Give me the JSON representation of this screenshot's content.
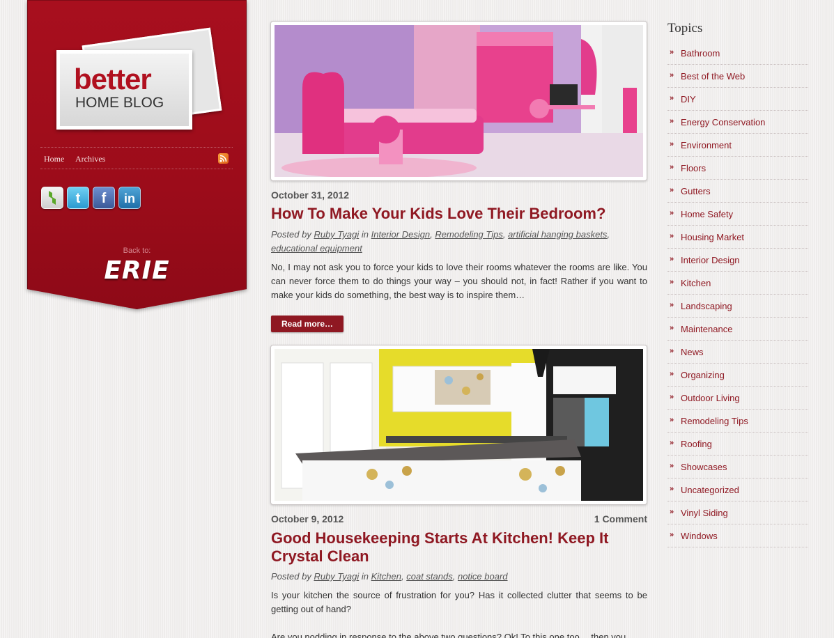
{
  "brand": {
    "logo_word1": "better",
    "logo_word2": "HOME BLOG",
    "back_to_label": "Back to:",
    "back_to_city": "ERIE"
  },
  "nav": {
    "home": "Home",
    "archives": "Archives",
    "rss_icon": "rss-icon"
  },
  "social": [
    {
      "name": "houzz-icon",
      "glyph": "h"
    },
    {
      "name": "twitter-icon",
      "glyph": "t"
    },
    {
      "name": "facebook-icon",
      "glyph": "f"
    },
    {
      "name": "linkedin-icon",
      "glyph": "in"
    }
  ],
  "posts": [
    {
      "date": "October 31, 2012",
      "title": "How To Make Your Kids Love Their Bedroom?",
      "posted_by": "Posted by",
      "author": "Ruby Tyagi",
      "in": "in",
      "tags": [
        "Interior Design",
        "Remodeling Tips",
        "artificial hanging baskets",
        "educational equipment"
      ],
      "excerpt": "No, I may not ask you to force your kids to love their rooms whatever the rooms are like. You can never force them to do things your way – you should not, in fact! Rather if you want to make your kids do something, the best way is to inspire them…",
      "read_more": "Read more…"
    },
    {
      "date": "October 9, 2012",
      "comments": "1 Comment",
      "title": "Good Housekeeping Starts At Kitchen! Keep It Crystal Clean",
      "posted_by": "Posted by",
      "author": "Ruby Tyagi",
      "in": "in",
      "tags": [
        "Kitchen",
        "coat stands",
        "notice board"
      ],
      "excerpt": "Is your kitchen the source of frustration for you? Has it collected clutter that seems to be getting out of hand?",
      "excerpt2": "Are you nodding in response to the above two questions? Ok! To this one too… then you"
    }
  ],
  "sidebar": {
    "title": "Topics",
    "chevron": "»",
    "topics": [
      "Bathroom",
      "Best of the Web",
      "DIY",
      "Energy Conservation",
      "Environment",
      "Floors",
      "Gutters",
      "Home Safety",
      "Housing Market",
      "Interior Design",
      "Kitchen",
      "Landscaping",
      "Maintenance",
      "News",
      "Organizing",
      "Outdoor Living",
      "Remodeling Tips",
      "Roofing",
      "Showcases",
      "Uncategorized",
      "Vinyl Siding",
      "Windows"
    ]
  },
  "colors": {
    "brand_red": "#9c0c1a",
    "link_red": "#8f1822"
  }
}
